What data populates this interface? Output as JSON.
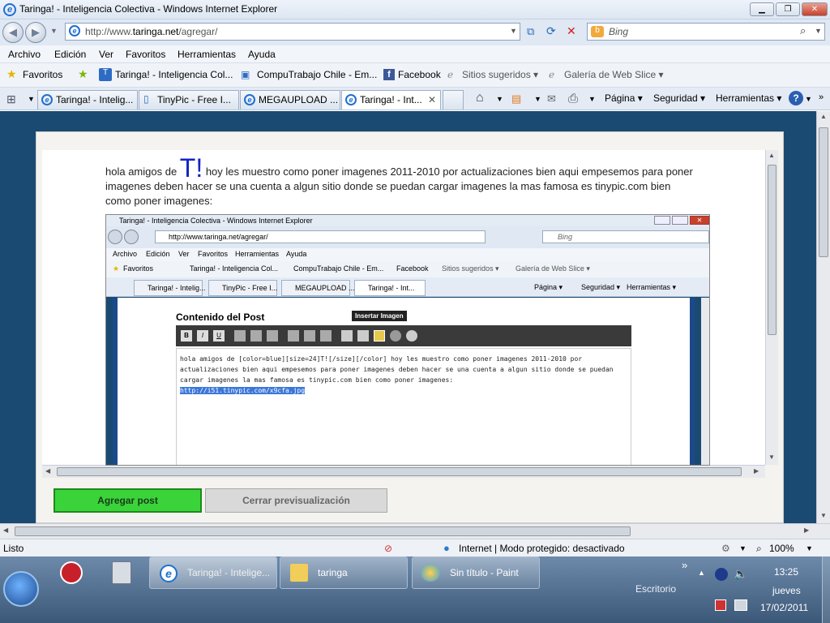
{
  "window": {
    "title": "Taringa! - Inteligencia Colectiva - Windows Internet Explorer",
    "min": "▁",
    "max": "❐",
    "close": "✕"
  },
  "address": {
    "prefix": "http://www.",
    "domain": "taringa.net",
    "path": "/agregar/",
    "search_placeholder": "Bing"
  },
  "menu": [
    "Archivo",
    "Edición",
    "Ver",
    "Favoritos",
    "Herramientas",
    "Ayuda"
  ],
  "favorites": {
    "label": "Favoritos",
    "items": [
      "Taringa! - Inteligencia Col...",
      "CompuTrabajo Chile - Em...",
      "Facebook",
      "Sitios sugeridos ▾",
      "Galería de Web Slice ▾"
    ]
  },
  "tabs": [
    "Taringa! - Intelig...",
    "TinyPic - Free I...",
    "MEGAUPLOAD ...",
    "Taringa! - Int..."
  ],
  "commands": [
    "Página ▾",
    "Seguridad ▾",
    "Herramientas ▾"
  ],
  "post": {
    "text_before": "hola amigos de ",
    "big_t": "T!",
    "text_after": " hoy les muestro como poner imagenes 2011-2010 por actualizaciones bien aqui empesemos para poner imagenes deben hacer se una cuenta a algun sitio donde se puedan cargar imagenes la mas famosa es tinypic.com bien como poner imagenes:"
  },
  "inner": {
    "title": "Taringa! - Inteligencia Colectiva - Windows Internet Explorer",
    "address": "http://www.taringa.net/agregar/",
    "search": "Bing",
    "menu": [
      "Archivo",
      "Edición",
      "Ver",
      "Favoritos",
      "Herramientas",
      "Ayuda"
    ],
    "fav": [
      "Favoritos",
      "Taringa! - Inteligencia Col...",
      "CompuTrabajo Chile - Em...",
      "Facebook",
      "Sitios sugeridos ▾",
      "Galería de Web Slice ▾"
    ],
    "tabs": [
      "Taringa! - Intelig...",
      "TinyPic - Free I...",
      "MEGAUPLOAD ...",
      "Taringa! - Int..."
    ],
    "commands": [
      "Página ▾",
      "Seguridad ▾",
      "Herramientas ▾"
    ],
    "content_title": "Contenido del Post",
    "tooltip": "Insertar Imagen",
    "editor_text": "hola amigos de [color=blue][size=24]T![/size][/color] hoy les muestro como poner imagenes 2011-2010 por actualizaciones bien aqui empesemos para poner imagenes deben hacer se una cuenta a algun sitio donde se puedan cargar imagenes la mas famosa es tinypic.com bien como poner imagenes:",
    "editor_link": "http://i51.tinypic.com/x9cfa.jpg"
  },
  "buttons": {
    "agregar": "Agregar post",
    "cerrar": "Cerrar previsualización"
  },
  "status": {
    "left": "Listo",
    "zone": "Internet | Modo protegido: desactivado",
    "zoom": "100%"
  },
  "taskbar": {
    "items": [
      "Taringa! - Intelige...",
      "taringa",
      "Sin título - Paint"
    ],
    "desktop": "Escritorio",
    "time": "13:25",
    "day": "jueves",
    "date": "17/02/2011"
  }
}
